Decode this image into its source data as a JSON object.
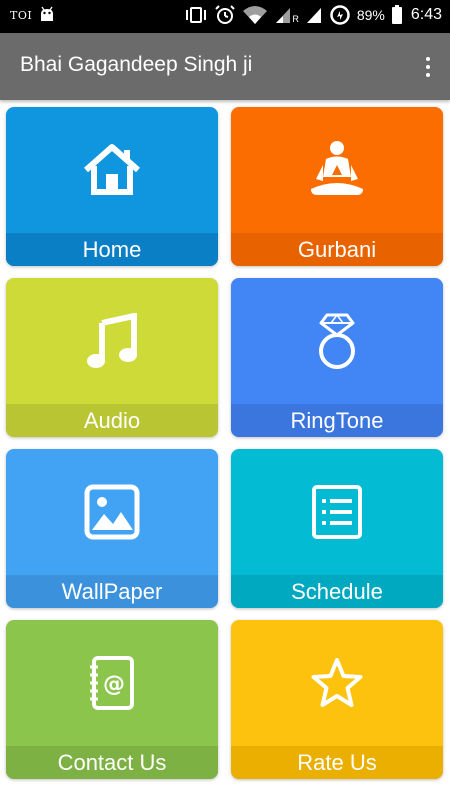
{
  "status_bar": {
    "notification_text": "TOI",
    "battery": "89%",
    "time": "6:43",
    "network_label": "R",
    "icons": [
      "toi-icon",
      "android-debug-icon",
      "vibrate-icon",
      "alarm-icon",
      "wifi-icon",
      "signal-icon",
      "signal-icon",
      "data-saver-icon",
      "battery-icon"
    ]
  },
  "app_bar": {
    "title": "Bhai Gagandeep Singh ji",
    "menu_icon": "overflow-menu-icon"
  },
  "tiles": [
    {
      "label": "Home",
      "icon": "home-icon",
      "color": "#0f96de",
      "label_color": "#0a7fc6"
    },
    {
      "label": "Gurbani",
      "icon": "meditation-icon",
      "color": "#fc6d00",
      "label_color": "#e86300"
    },
    {
      "label": "Audio",
      "icon": "music-note-icon",
      "color": "#cdda38",
      "label_color": "#b9c532"
    },
    {
      "label": "RingTone",
      "icon": "diamond-ring-icon",
      "color": "#4285f4",
      "label_color": "#3a76de"
    },
    {
      "label": "WallPaper",
      "icon": "image-icon",
      "color": "#42a2f3",
      "label_color": "#3b91dc"
    },
    {
      "label": "Schedule",
      "icon": "schedule-list-icon",
      "color": "#03bcd4",
      "label_color": "#00a9bf"
    },
    {
      "label": "Contact Us",
      "icon": "contact-book-icon",
      "color": "#8cc54c",
      "label_color": "#7db143"
    },
    {
      "label": "Rate Us",
      "icon": "star-icon",
      "color": "#fdc20d",
      "label_color": "#eaaf00"
    }
  ]
}
